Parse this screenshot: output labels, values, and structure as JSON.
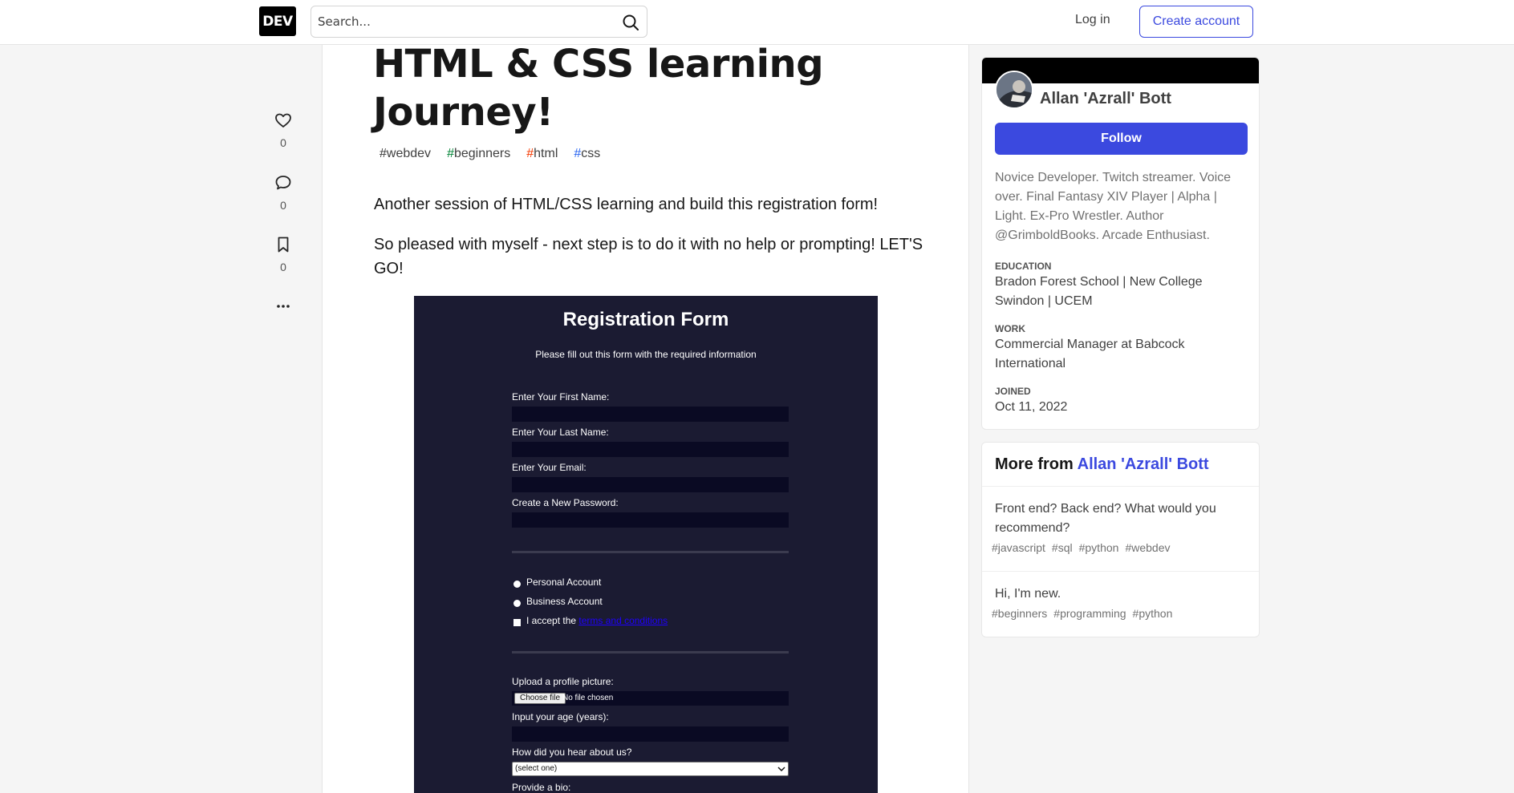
{
  "header": {
    "logo": "DEV",
    "search_placeholder": "Search...",
    "login_label": "Log in",
    "create_account_label": "Create account"
  },
  "actions": {
    "reactions_count": "0",
    "comments_count": "0",
    "saves_count": "0"
  },
  "article": {
    "title": "HTML & CSS learning Journey!",
    "tags": [
      {
        "name": "webdev",
        "color": "#3a3a3a"
      },
      {
        "name": "beginners",
        "color": "#008335"
      },
      {
        "name": "html",
        "color": "#f53900"
      },
      {
        "name": "css",
        "color": "#2965f1"
      }
    ],
    "paragraph1": "Another session of HTML/CSS learning and build this registration form!",
    "paragraph2": "So pleased with myself - next step is to do it with no help or prompting! LET'S GO!",
    "form_image": {
      "title": "Registration Form",
      "subtitle": "Please fill out this form with the required information",
      "first_name_label": "Enter Your First Name:",
      "last_name_label": "Enter Your Last Name:",
      "email_label": "Enter Your Email:",
      "password_label": "Create a New Password:",
      "personal_account": "Personal Account",
      "business_account": "Business Account",
      "terms_prefix": "I accept the",
      "terms_link": "terms and conditions",
      "upload_label": "Upload a profile picture:",
      "choose_file": "Choose file",
      "no_file": "No file chosen",
      "age_label": "Input your age (years):",
      "referrer_label": "How did you hear about us?",
      "select_placeholder": "(select one)",
      "bio_label": "Provide a bio:"
    }
  },
  "profile": {
    "name": "Allan 'Azrall' Bott",
    "follow_label": "Follow",
    "bio": "Novice Developer. Twitch streamer. Voice over. Final Fantasy XIV Player | Alpha | Light. Ex-Pro Wrestler. Author @GrimboldBooks. Arcade Enthusiast.",
    "education_label": "Education",
    "education_value": "Bradon Forest School | New College Swindon | UCEM",
    "work_label": "Work",
    "work_value": "Commercial Manager at Babcock International",
    "joined_label": "Joined",
    "joined_value": "Oct 11, 2022"
  },
  "more_from": {
    "prefix": "More from",
    "author": "Allan 'Azrall' Bott",
    "posts": [
      {
        "title": "Front end? Back end? What would you recommend?",
        "tags": [
          "#javascript",
          "#sql",
          "#python",
          "#webdev"
        ]
      },
      {
        "title": "Hi, I'm new.",
        "tags": [
          "#beginners",
          "#programming",
          "#python"
        ]
      }
    ]
  },
  "colors": {
    "accent": "#3b49df",
    "form_bg": "#1b1b32",
    "page_bg": "#f5f5f5"
  }
}
